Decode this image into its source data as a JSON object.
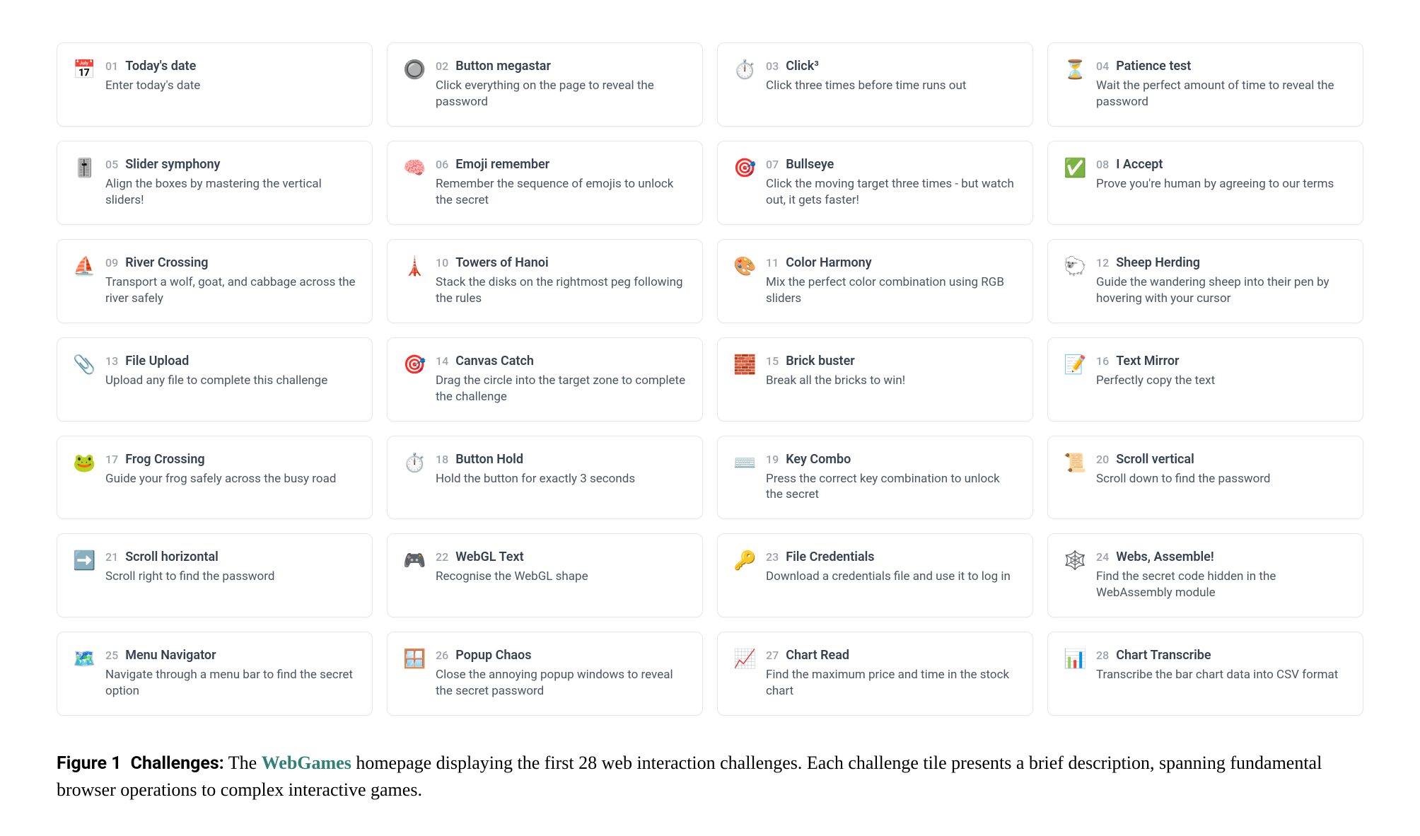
{
  "challenges": [
    {
      "num": "01",
      "icon": "📅",
      "title": "Today's date",
      "desc": "Enter today's date"
    },
    {
      "num": "02",
      "icon": "🔘",
      "title": "Button megastar",
      "desc": "Click everything on the page to reveal the password"
    },
    {
      "num": "03",
      "icon": "⏱️",
      "title": "Click³",
      "desc": "Click three times before time runs out"
    },
    {
      "num": "04",
      "icon": "⏳",
      "title": "Patience test",
      "desc": "Wait the perfect amount of time to reveal the password"
    },
    {
      "num": "05",
      "icon": "🎚️",
      "title": "Slider symphony",
      "desc": "Align the boxes by mastering the vertical sliders!"
    },
    {
      "num": "06",
      "icon": "🧠",
      "title": "Emoji remember",
      "desc": "Remember the sequence of emojis to unlock the secret"
    },
    {
      "num": "07",
      "icon": "🎯",
      "title": "Bullseye",
      "desc": "Click the moving target three times - but watch out, it gets faster!"
    },
    {
      "num": "08",
      "icon": "✅",
      "title": "I Accept",
      "desc": "Prove you're human by agreeing to our terms"
    },
    {
      "num": "09",
      "icon": "⛵",
      "title": "River Crossing",
      "desc": "Transport a wolf, goat, and cabbage across the river safely"
    },
    {
      "num": "10",
      "icon": "🗼",
      "title": "Towers of Hanoi",
      "desc": "Stack the disks on the rightmost peg following the rules"
    },
    {
      "num": "11",
      "icon": "🎨",
      "title": "Color Harmony",
      "desc": "Mix the perfect color combination using RGB sliders"
    },
    {
      "num": "12",
      "icon": "🐑",
      "title": "Sheep Herding",
      "desc": "Guide the wandering sheep into their pen by hovering with your cursor"
    },
    {
      "num": "13",
      "icon": "📎",
      "title": "File Upload",
      "desc": "Upload any file to complete this challenge"
    },
    {
      "num": "14",
      "icon": "🎯",
      "title": "Canvas Catch",
      "desc": "Drag the circle into the target zone to complete the challenge"
    },
    {
      "num": "15",
      "icon": "🧱",
      "title": "Brick buster",
      "desc": "Break all the bricks to win!"
    },
    {
      "num": "16",
      "icon": "📝",
      "title": "Text Mirror",
      "desc": "Perfectly copy the text"
    },
    {
      "num": "17",
      "icon": "🐸",
      "title": "Frog Crossing",
      "desc": "Guide your frog safely across the busy road"
    },
    {
      "num": "18",
      "icon": "⏱️",
      "title": "Button Hold",
      "desc": "Hold the button for exactly 3 seconds"
    },
    {
      "num": "19",
      "icon": "⌨️",
      "title": "Key Combo",
      "desc": "Press the correct key combination to unlock the secret"
    },
    {
      "num": "20",
      "icon": "📜",
      "title": "Scroll vertical",
      "desc": "Scroll down to find the password"
    },
    {
      "num": "21",
      "icon": "➡️",
      "title": "Scroll horizontal",
      "desc": "Scroll right to find the password"
    },
    {
      "num": "22",
      "icon": "🎮",
      "title": "WebGL Text",
      "desc": "Recognise the WebGL shape"
    },
    {
      "num": "23",
      "icon": "🔑",
      "title": "File Credentials",
      "desc": "Download a credentials file and use it to log in"
    },
    {
      "num": "24",
      "icon": "🕸️",
      "title": "Webs, Assemble!",
      "desc": "Find the secret code hidden in the WebAssembly module"
    },
    {
      "num": "25",
      "icon": "🗺️",
      "title": "Menu Navigator",
      "desc": "Navigate through a menu bar to find the secret option"
    },
    {
      "num": "26",
      "icon": "🪟",
      "title": "Popup Chaos",
      "desc": "Close the annoying popup windows to reveal the secret password"
    },
    {
      "num": "27",
      "icon": "📈",
      "title": "Chart Read",
      "desc": "Find the maximum price and time in the stock chart"
    },
    {
      "num": "28",
      "icon": "📊",
      "title": "Chart Transcribe",
      "desc": "Transcribe the bar chart data into CSV format"
    }
  ],
  "caption": {
    "figure": "Figure 1",
    "lead": "Challenges:",
    "pre": "The",
    "brand": "WebGames",
    "rest": "homepage displaying the first 28 web interaction challenges. Each challenge tile presents a brief description, spanning fundamental browser operations to complex interactive games."
  }
}
